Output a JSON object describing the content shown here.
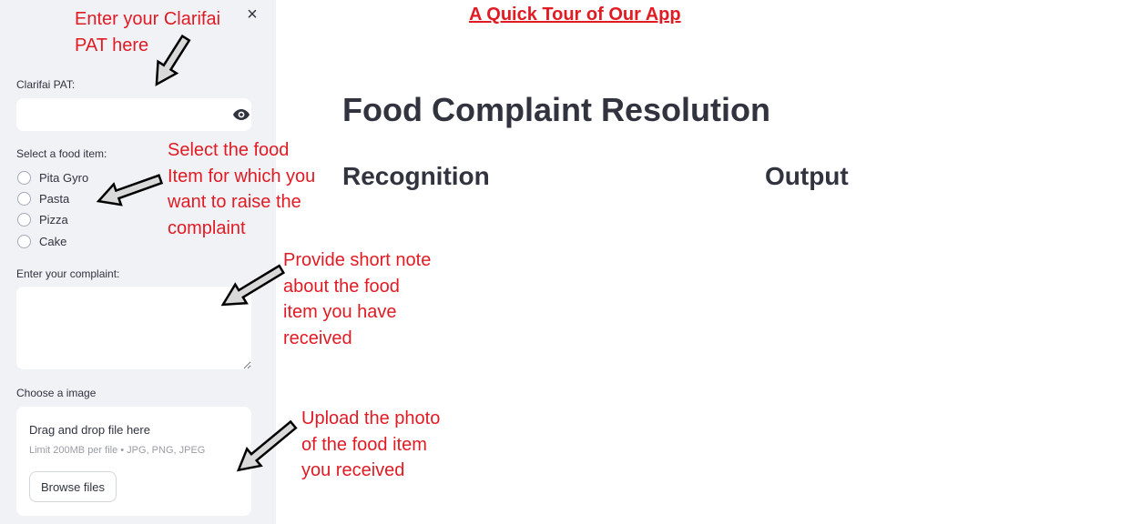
{
  "sidebar": {
    "close_glyph": "×",
    "pat_label": "Clarifai PAT:",
    "pat_value": "",
    "food_label": "Select a food item:",
    "food_options": [
      "Pita Gyro",
      "Pasta",
      "Pizza",
      "Cake"
    ],
    "complaint_label": "Enter your complaint:",
    "complaint_value": "",
    "image_label": "Choose a image",
    "dropzone": {
      "title": "Drag and drop file here",
      "subtitle": "Limit 200MB per file • JPG, PNG, JPEG",
      "browse_label": "Browse files"
    }
  },
  "main": {
    "tour_link": "A Quick Tour of Our App",
    "title": "Food Complaint Resolution",
    "col_recognition": "Recognition",
    "col_output": "Output"
  },
  "annotations": {
    "pat": [
      "Enter your Clarifai",
      "PAT here"
    ],
    "food": [
      "Select the food",
      "Item for which you",
      "want to raise the",
      "complaint"
    ],
    "note": [
      "Provide short note",
      "about the food",
      "item you have",
      "received"
    ],
    "upload": [
      "Upload the photo",
      "of the food item",
      "you received"
    ]
  },
  "colors": {
    "sidebar_bg": "#f0f2f6",
    "annotation_red": "#e01b24",
    "text_dark": "#31333f"
  },
  "icons": {
    "close": "close-icon",
    "eye": "eye-icon",
    "arrow": "arrow-icon"
  }
}
